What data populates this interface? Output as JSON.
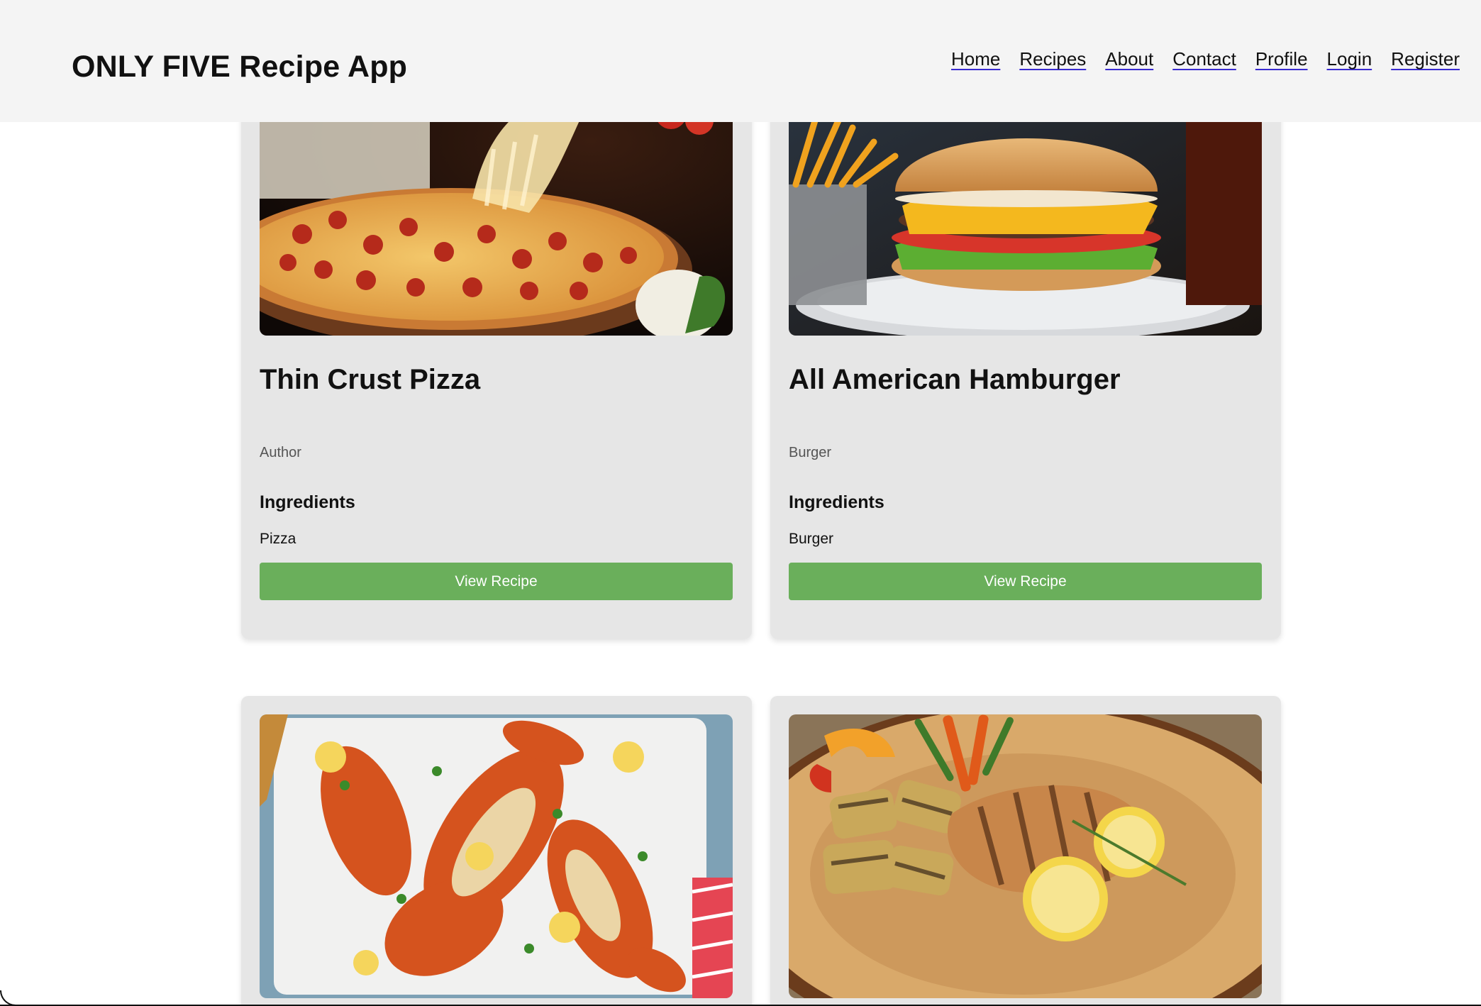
{
  "header": {
    "title": "ONLY FIVE Recipe App",
    "nav": [
      "Home",
      "Recipes",
      "About",
      "Contact",
      "Profile",
      "Login",
      "Register"
    ]
  },
  "recipes": [
    {
      "title": "Thin Crust Pizza",
      "meta": "Author",
      "ingredients_heading": "Ingredients",
      "ingredients": "Pizza",
      "button": "View Recipe",
      "image": "pizza-photo"
    },
    {
      "title": "All American Hamburger",
      "meta": "Burger",
      "ingredients_heading": "Ingredients",
      "ingredients": "Burger",
      "button": "View Recipe",
      "image": "hamburger-photo"
    },
    {
      "image": "lobster-photo"
    },
    {
      "image": "grilled-chicken-photo"
    }
  ],
  "colors": {
    "header_bg": "#f4f4f4",
    "card_bg": "#e6e6e6",
    "button_bg": "#6aaf5b"
  }
}
